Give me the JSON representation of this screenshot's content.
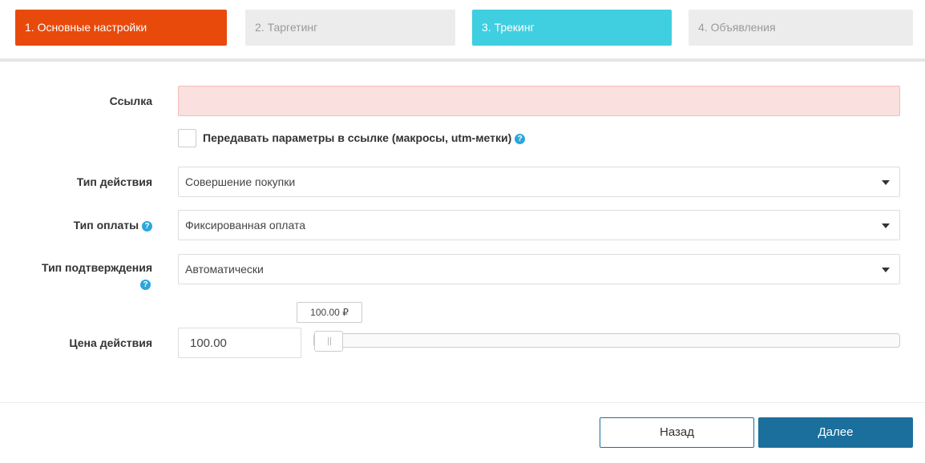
{
  "steps": [
    {
      "label": "1. Основные настройки",
      "state": "active",
      "color": "#e84a0c"
    },
    {
      "label": "2. Таргетинг",
      "state": "inactive",
      "color": "#ececec"
    },
    {
      "label": "3. Трекинг",
      "state": "highlighted",
      "color": "#3fcfe0"
    },
    {
      "label": "4. Объявления",
      "state": "inactive",
      "color": "#ececec"
    }
  ],
  "form": {
    "link": {
      "label": "Ссылка",
      "value": ""
    },
    "pass_params": {
      "label": "Передавать параметры в ссылке (макросы, utm-метки)",
      "checked": false,
      "icon": "help-icon"
    },
    "action_type": {
      "label": "Тип действия",
      "value": "Совершение покупки"
    },
    "payment_type": {
      "label": "Тип оплаты",
      "value": "Фиксированная оплата",
      "icon": "help-icon"
    },
    "confirmation_type": {
      "label": "Тип подтверждения",
      "value": "Автоматически",
      "icon": "help-icon"
    },
    "price": {
      "label": "Цена действия",
      "value": "100.00",
      "tooltip": "100.00 ₽",
      "slider_fraction": 0
    }
  },
  "footer": {
    "back_label": "Назад",
    "next_label": "Далее"
  },
  "colors": {
    "accent": "#e84a0c",
    "secondary": "#3fcfe0",
    "primary_button": "#1a6f9c",
    "error_field": "#fbe0e0",
    "help_icon": "#2aa7dc"
  }
}
